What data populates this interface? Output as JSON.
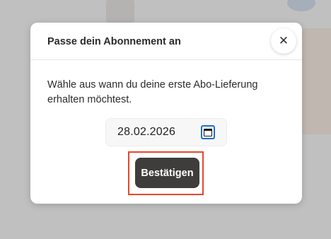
{
  "modal": {
    "title": "Passe dein Abonnement an",
    "close_icon": "close-icon",
    "description": "Wähle aus wann du deine erste Abo-Lieferung erhalten möchtest.",
    "date_input": {
      "value": "28.02.2026",
      "calendar_icon": "calendar-icon"
    },
    "confirm_label": "Bestätigen"
  },
  "colors": {
    "confirm_button": "#3e3d3b",
    "highlight_border": "#e8472b",
    "focus_outline": "#1c6dd0"
  }
}
